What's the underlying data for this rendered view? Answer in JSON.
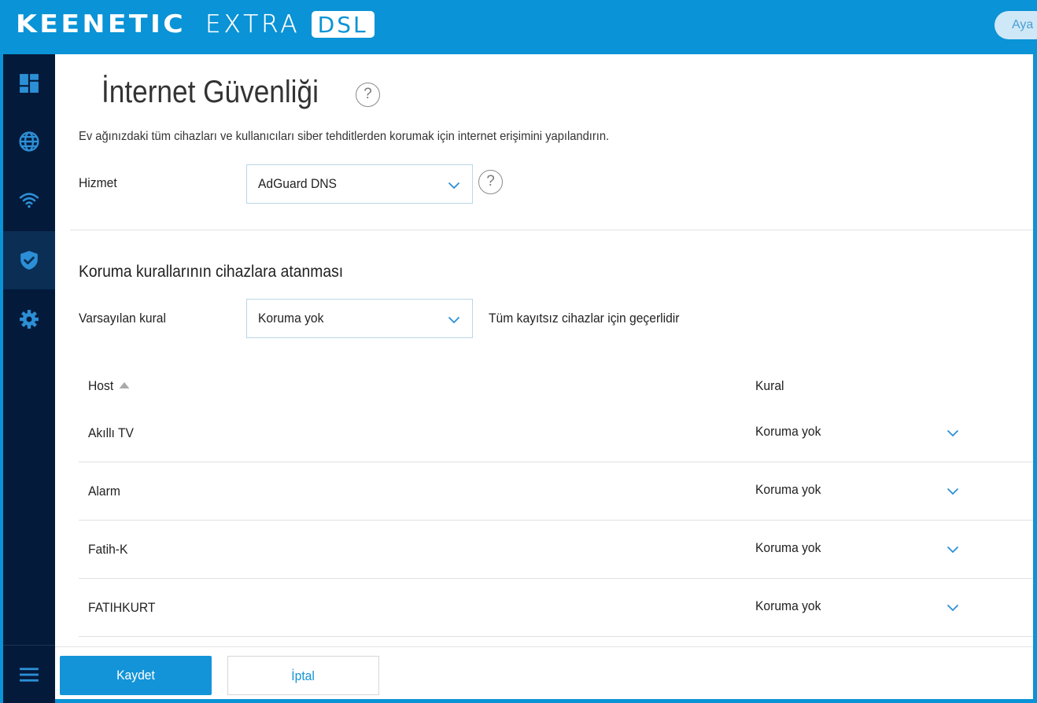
{
  "header": {
    "brand": "KEENETIC",
    "model": "EXTRA",
    "model_badge": "DSL",
    "top_button": "Aya"
  },
  "sidebar": {
    "items": [
      {
        "name": "dashboard",
        "icon": "dashboard-icon"
      },
      {
        "name": "internet",
        "icon": "globe-icon"
      },
      {
        "name": "wifi",
        "icon": "wifi-icon"
      },
      {
        "name": "security",
        "icon": "shield-check-icon",
        "active": true
      },
      {
        "name": "settings",
        "icon": "gear-icon"
      }
    ],
    "menu_icon": "hamburger-icon"
  },
  "page": {
    "title": "İnternet Güvenliği",
    "description": "Ev ağınızdaki tüm cihazları ve kullanıcıları siber tehditlerden korumak için internet erişimini yapılandırın.",
    "service": {
      "label": "Hizmet",
      "value": "AdGuard DNS"
    },
    "assignment": {
      "title": "Koruma kurallarının cihazlara atanması",
      "default_rule_label": "Varsayılan kural",
      "default_rule_value": "Koruma yok",
      "default_rule_note": "Tüm kayıtsız cihazlar için geçerlidir"
    },
    "table": {
      "columns": [
        "Host",
        "Kural"
      ],
      "sort": {
        "column": "Host",
        "direction": "ascending"
      },
      "rows": [
        {
          "host": "Akıllı TV",
          "rule": "Koruma yok"
        },
        {
          "host": "Alarm",
          "rule": "Koruma yok"
        },
        {
          "host": "Fatih-K",
          "rule": "Koruma yok"
        },
        {
          "host": "FATIHKURT",
          "rule": "Koruma yok"
        }
      ]
    }
  },
  "footer": {
    "save_label": "Kaydet",
    "cancel_label": "İptal"
  },
  "colors": {
    "brand_blue": "#0a93d6",
    "sidebar_bg": "#041a3b",
    "sidebar_active": "#0a2e54",
    "icon_blue": "#2c8fd6",
    "button_blue": "#1394d8"
  }
}
